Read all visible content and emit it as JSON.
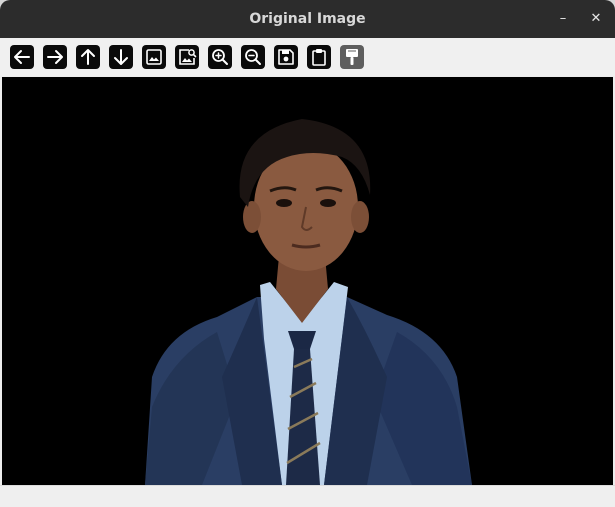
{
  "window": {
    "title": "Original Image",
    "minimize_glyph": "–",
    "close_glyph": "✕"
  },
  "toolbar": {
    "buttons": [
      {
        "icon": "arrow-left-icon",
        "enabled": true
      },
      {
        "icon": "arrow-right-icon",
        "enabled": true
      },
      {
        "icon": "arrow-up-icon",
        "enabled": true
      },
      {
        "icon": "arrow-down-icon",
        "enabled": true
      },
      {
        "icon": "image-icon",
        "enabled": true
      },
      {
        "icon": "image-search-icon",
        "enabled": true
      },
      {
        "icon": "zoom-in-icon",
        "enabled": true
      },
      {
        "icon": "zoom-out-icon",
        "enabled": true
      },
      {
        "icon": "save-icon",
        "enabled": true
      },
      {
        "icon": "clipboard-icon",
        "enabled": true
      },
      {
        "icon": "paint-brush-icon",
        "enabled": false
      }
    ]
  },
  "image": {
    "subject": "portrait photo",
    "background_color": "#000000"
  },
  "colors": {
    "titlebar": "#2c2c2c",
    "toolbar": "#f0f0f0",
    "button": "#0a0a0a",
    "button_disabled": "#5e5e5e",
    "jacket": "#2a3e64",
    "shirt": "#bcd2ea",
    "skin": "#8a5a40",
    "hair": "#1b1412"
  }
}
